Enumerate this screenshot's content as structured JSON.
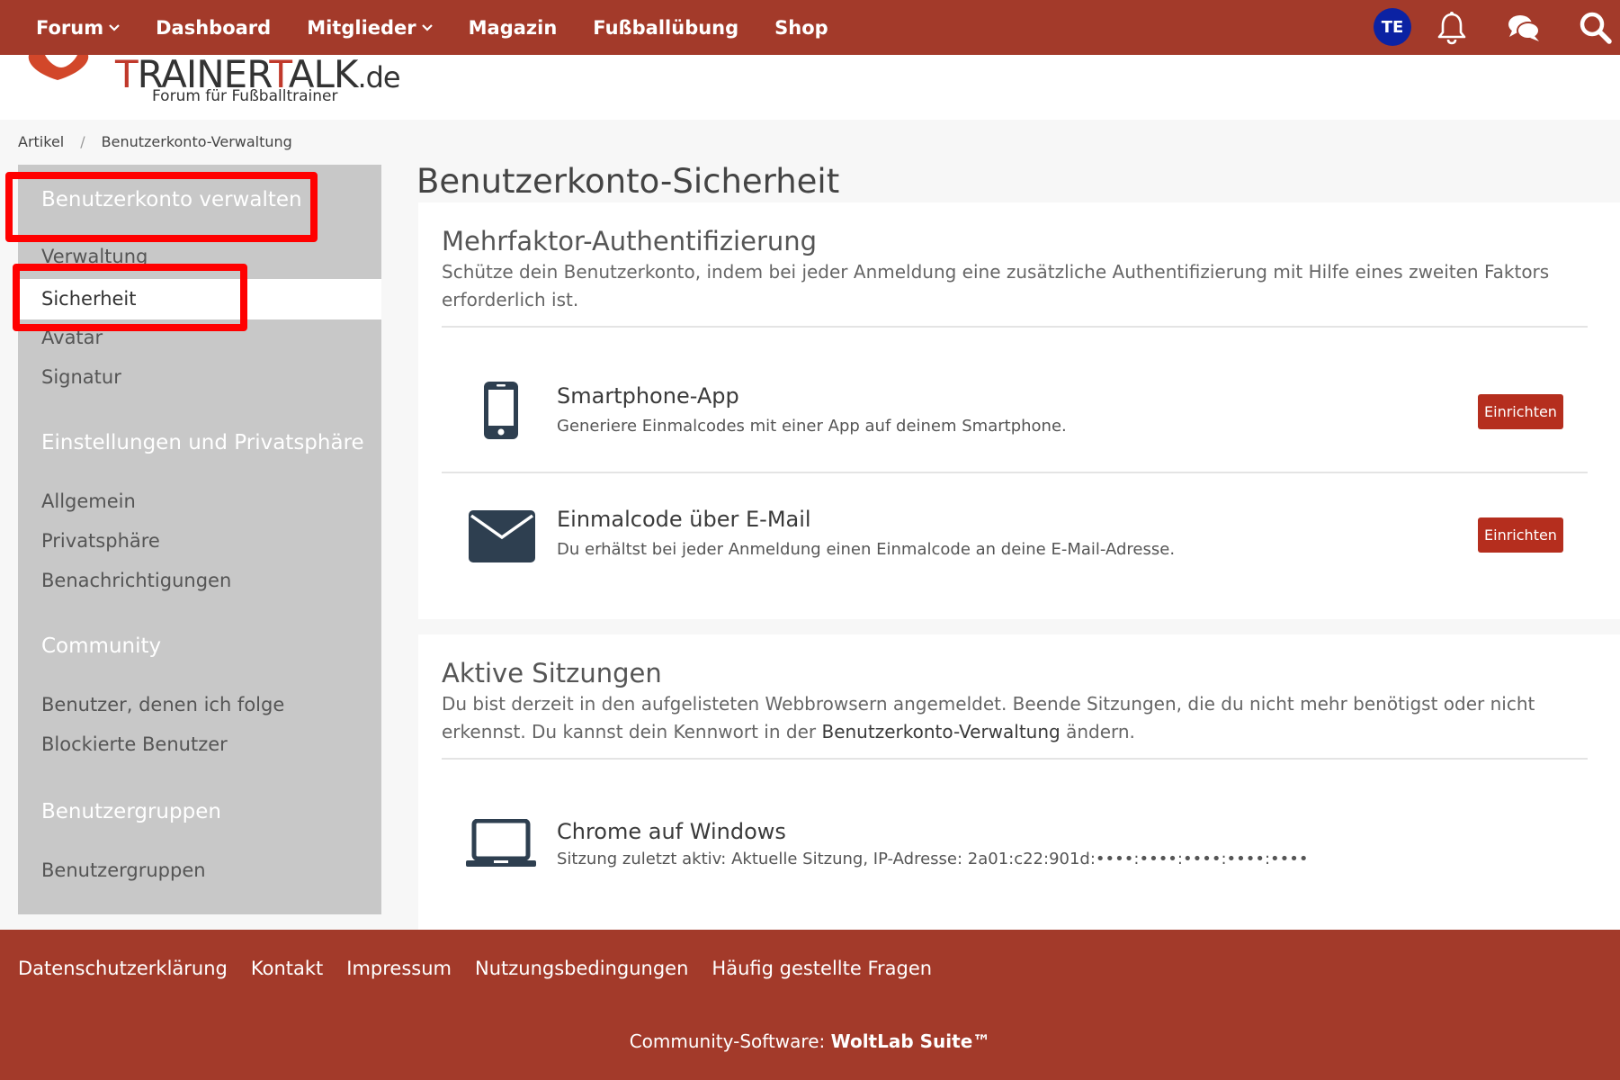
{
  "nav": {
    "items": [
      {
        "label": "Forum",
        "dropdown": true
      },
      {
        "label": "Dashboard",
        "dropdown": false
      },
      {
        "label": "Mitglieder",
        "dropdown": true
      },
      {
        "label": "Magazin",
        "dropdown": false
      },
      {
        "label": "Fußballübung",
        "dropdown": false
      },
      {
        "label": "Shop",
        "dropdown": false
      }
    ],
    "avatar_initials": "TE",
    "icons": [
      "bell-icon",
      "chat-bubbles-icon",
      "search-icon"
    ]
  },
  "logo": {
    "text_a": "T",
    "text_b": "RAINER",
    "text_c": "T",
    "text_d": "ALK",
    "text_e": ".de",
    "tagline": "Forum für Fußballtrainer"
  },
  "breadcrumb": {
    "items": [
      "Artikel",
      "Benutzerkonto-Verwaltung"
    ],
    "separator": "/"
  },
  "sidebar": {
    "sections": [
      {
        "title": "Benutzerkonto verwalten",
        "items": [
          "Verwaltung",
          "Sicherheit",
          "Avatar",
          "Signatur"
        ]
      },
      {
        "title": "Einstellungen und Privatsphäre",
        "items": [
          "Allgemein",
          "Privatsphäre",
          "Benachrichtigungen"
        ]
      },
      {
        "title": "Community",
        "items": [
          "Benutzer, denen ich folge",
          "Blockierte Benutzer"
        ]
      },
      {
        "title": "Benutzergruppen",
        "items": [
          "Benutzergruppen"
        ]
      }
    ],
    "active_item": "Sicherheit"
  },
  "main": {
    "title": "Benutzerkonto-Sicherheit",
    "mfa": {
      "title": "Mehrfaktor-Authentifizierung",
      "description": "Schütze dein Benutzerkonto, indem bei jeder Anmeldung eine zusätzliche Authentifizierung mit Hilfe eines zweiten Faktors erforderlich ist.",
      "methods": [
        {
          "icon": "smartphone-icon",
          "title": "Smartphone-App",
          "description": "Generiere Einmalcodes mit einer App auf deinem Smartphone.",
          "button": "Einrichten"
        },
        {
          "icon": "envelope-icon",
          "title": "Einmalcode über E-Mail",
          "description": "Du erhältst bei jeder Anmeldung einen Einmalcode an deine E-Mail-Adresse.",
          "button": "Einrichten"
        }
      ]
    },
    "sessions": {
      "title": "Aktive Sitzungen",
      "description_1": "Du bist derzeit in den aufgelisteten Webbrowsern angemeldet. Beende Sitzungen, die du nicht mehr benötigst oder nicht erkennst. Du kannst dein Kennwort in der ",
      "description_link": "Benutzerkonto-Verwaltung",
      "description_2": " ändern.",
      "items": [
        {
          "icon": "laptop-icon",
          "title": "Chrome auf Windows",
          "detail": "Sitzung zuletzt aktiv: Aktuelle Sitzung, IP-Adresse: 2a01:c22:901d:••••:••••:••••:••••:••••"
        }
      ]
    }
  },
  "footer": {
    "links": [
      "Datenschutzerklärung",
      "Kontakt",
      "Impressum",
      "Nutzungsbedingungen",
      "Häufig gestellte Fragen"
    ],
    "credit_prefix": "Community-Software: ",
    "credit_brand": "WoltLab Suite™"
  },
  "colors": {
    "brand": "#a33a2a",
    "button": "#b52e1e",
    "avatar": "#0b22a3",
    "sidebar": "#c8c8c8",
    "highlight": "#ff0000"
  }
}
